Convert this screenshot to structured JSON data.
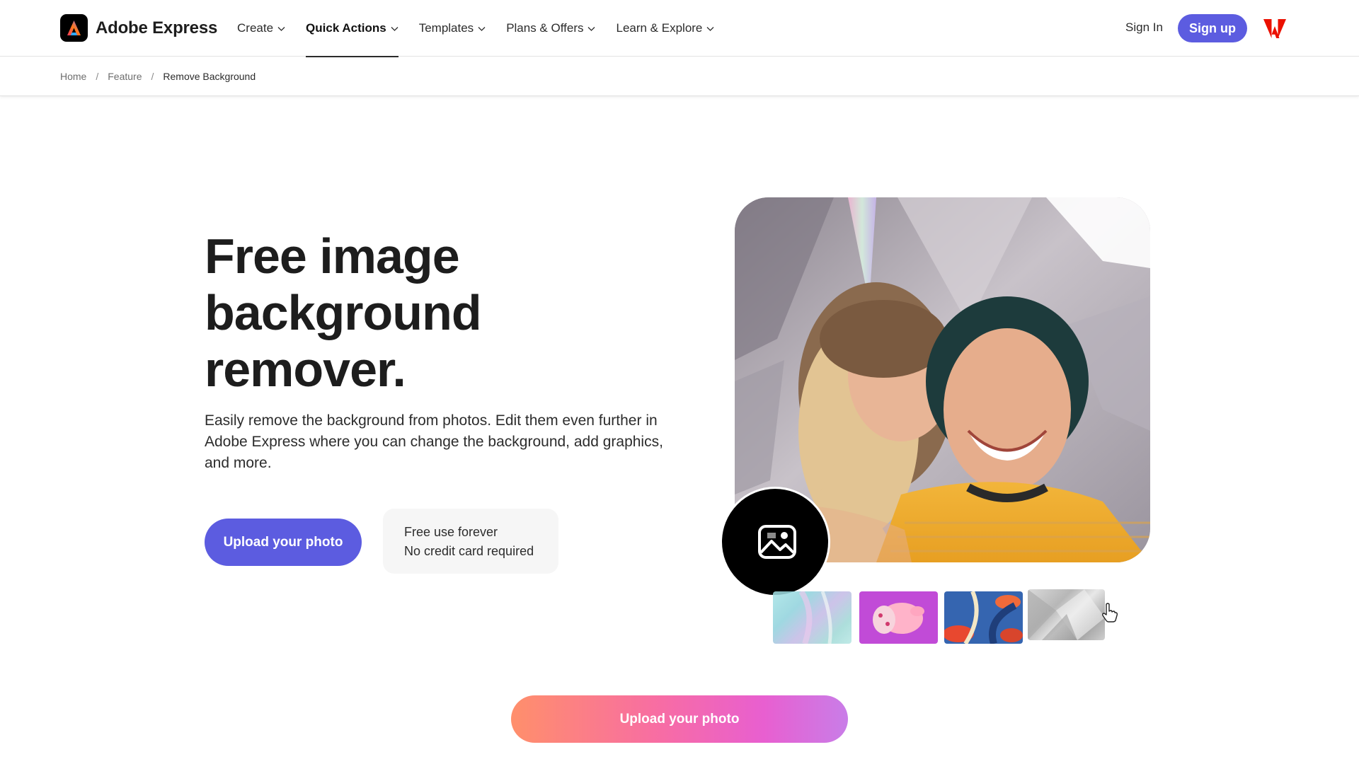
{
  "header": {
    "brand": "Adobe Express",
    "nav": [
      {
        "label": "Create",
        "active": false
      },
      {
        "label": "Quick Actions",
        "active": true
      },
      {
        "label": "Templates",
        "active": false
      },
      {
        "label": "Plans & Offers",
        "active": false
      },
      {
        "label": "Learn & Explore",
        "active": false
      }
    ],
    "sign_in": "Sign In",
    "sign_up": "Sign up"
  },
  "breadcrumb": {
    "items": [
      "Home",
      "Feature",
      "Remove Background"
    ],
    "separator": "/"
  },
  "hero": {
    "title_lines": [
      "Free image",
      "background",
      "remover."
    ],
    "description": "Easily remove the background from photos. Edit them even further in Adobe Express where you can change the background, add graphics, and more.",
    "upload_button": "Upload your photo",
    "free_lines": [
      "Free use forever",
      "No credit card required"
    ]
  },
  "media": {
    "photo_subject": "two smiling women against a holographic backdrop",
    "upload_icon": "image-icon",
    "background_thumbnails": [
      "holographic-teal",
      "pink-character-purple",
      "tropical-flowers-blue",
      "silver-crystal"
    ]
  },
  "cta": {
    "label": "Upload your photo"
  },
  "colors": {
    "accent": "#5c5ce0",
    "adobe_red": "#eb1000",
    "cta_gradient_start": "#ff8f6b",
    "cta_gradient_end": "#c97de8"
  }
}
